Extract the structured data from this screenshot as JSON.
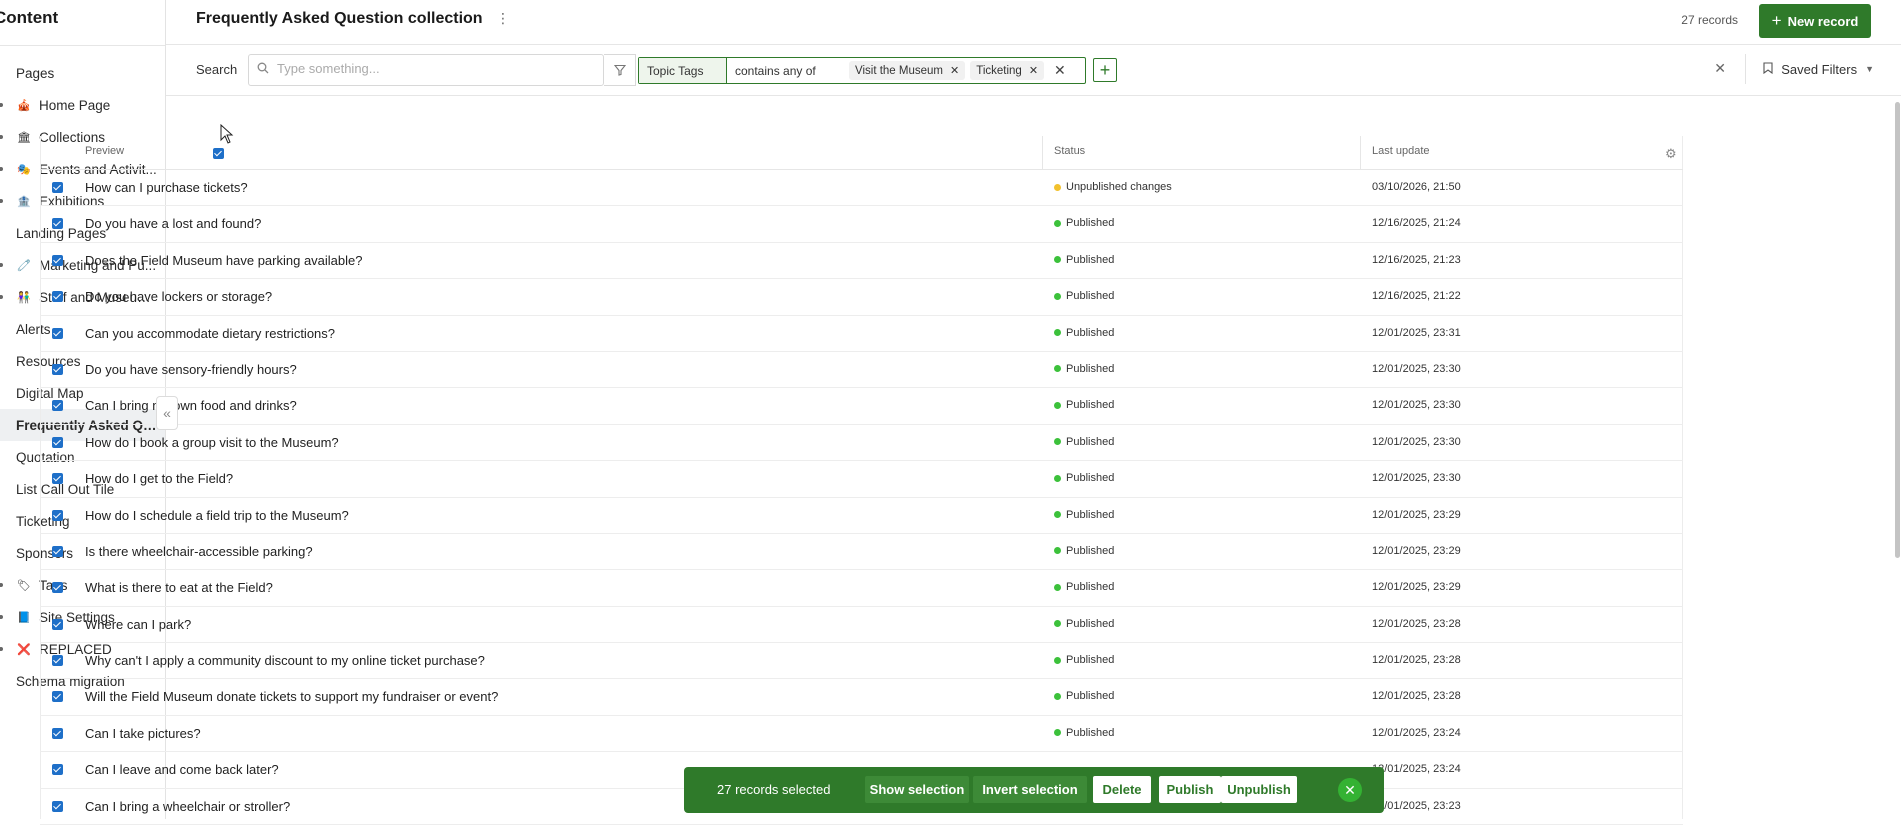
{
  "sidebar": {
    "title": "Content",
    "items": [
      {
        "label": "Pages",
        "level": 0,
        "icon": ""
      },
      {
        "label": "Home Page",
        "level": 1,
        "icon": "🎪"
      },
      {
        "label": "Collections",
        "level": 1,
        "icon": "🏛"
      },
      {
        "label": "Events and Activit...",
        "level": 1,
        "icon": "🎭"
      },
      {
        "label": "Exhibitions",
        "level": 1,
        "icon": "🏦"
      },
      {
        "label": "Landing Pages",
        "level": 0,
        "icon": ""
      },
      {
        "label": "Marketing and Pu...",
        "level": 1,
        "icon": "🧷"
      },
      {
        "label": "Staff and Museum...",
        "level": 1,
        "icon": "👫"
      },
      {
        "label": "Alerts",
        "level": 0,
        "icon": ""
      },
      {
        "label": "Resources",
        "level": 0,
        "icon": ""
      },
      {
        "label": "Digital Map",
        "level": 0,
        "icon": ""
      },
      {
        "label": "Frequently Asked Que...",
        "level": 0,
        "icon": "",
        "selected": true
      },
      {
        "label": "Quotation",
        "level": 0,
        "icon": ""
      },
      {
        "label": "List Call Out Tile",
        "level": 0,
        "icon": ""
      },
      {
        "label": "Ticketing",
        "level": 0,
        "icon": ""
      },
      {
        "label": "Sponsors",
        "level": 0,
        "icon": ""
      },
      {
        "label": "Tags",
        "level": 1,
        "icon": "🏷"
      },
      {
        "label": "Site Settings",
        "level": 1,
        "icon": "📘"
      },
      {
        "label": "REPLACED",
        "level": 1,
        "icon": "❌"
      },
      {
        "label": "Schema migration",
        "level": 0,
        "icon": ""
      }
    ]
  },
  "header": {
    "title": "Frequently Asked Question collection",
    "record_count": "27 records",
    "new_record_label": "New record"
  },
  "filterbar": {
    "search_label": "Search",
    "search_placeholder": "Type something...",
    "filter_field": "Topic Tags",
    "filter_operator": "contains any of",
    "filter_values": [
      "Visit the Museum",
      "Ticketing"
    ],
    "saved_filters_label": "Saved Filters"
  },
  "table": {
    "columns": [
      "Preview",
      "Status",
      "Last update"
    ],
    "rows": [
      {
        "preview": "How can I purchase tickets?",
        "status": "Unpublished changes",
        "date": "03/10/2026, 21:50"
      },
      {
        "preview": "Do you have a lost and found?",
        "status": "Published",
        "date": "12/16/2025, 21:24"
      },
      {
        "preview": "Does the Field Museum have parking available?",
        "status": "Published",
        "date": "12/16/2025, 21:23"
      },
      {
        "preview": "Do you have lockers or storage?",
        "status": "Published",
        "date": "12/16/2025, 21:22"
      },
      {
        "preview": "Can you accommodate dietary restrictions?",
        "status": "Published",
        "date": "12/01/2025, 23:31"
      },
      {
        "preview": "Do you have sensory-friendly hours?",
        "status": "Published",
        "date": "12/01/2025, 23:30"
      },
      {
        "preview": "Can I bring my own food and drinks?",
        "status": "Published",
        "date": "12/01/2025, 23:30"
      },
      {
        "preview": "How do I book a group visit to the Museum?",
        "status": "Published",
        "date": "12/01/2025, 23:30"
      },
      {
        "preview": "How do I get to the Field?",
        "status": "Published",
        "date": "12/01/2025, 23:30"
      },
      {
        "preview": "How do I schedule a field trip to the Museum?",
        "status": "Published",
        "date": "12/01/2025, 23:29"
      },
      {
        "preview": "Is there wheelchair-accessible parking?",
        "status": "Published",
        "date": "12/01/2025, 23:29"
      },
      {
        "preview": "What is there to eat at the Field?",
        "status": "Published",
        "date": "12/01/2025, 23:29"
      },
      {
        "preview": "Where can I park?",
        "status": "Published",
        "date": "12/01/2025, 23:28"
      },
      {
        "preview": "Why can't I apply a community discount to my online ticket purchase?",
        "status": "Published",
        "date": "12/01/2025, 23:28"
      },
      {
        "preview": "Will the Field Museum donate tickets to support my fundraiser or event?",
        "status": "Published",
        "date": "12/01/2025, 23:28"
      },
      {
        "preview": "Can I take pictures?",
        "status": "Published",
        "date": "12/01/2025, 23:24"
      },
      {
        "preview": "Can I leave and come back later?",
        "status": "",
        "date": "12/01/2025, 23:24"
      },
      {
        "preview": "Can I bring a wheelchair or stroller?",
        "status": "",
        "date": "12/01/2025, 23:23"
      }
    ]
  },
  "bulk": {
    "selected_text": "27 records selected",
    "show_selection": "Show selection",
    "invert_selection": "Invert selection",
    "delete": "Delete",
    "publish": "Publish",
    "unpublish": "Unpublish"
  },
  "colors": {
    "accent": "#2f7a2a",
    "published": "#3cc13b",
    "unpublished": "#f2c12e",
    "checkbox": "#1e6fc8"
  }
}
